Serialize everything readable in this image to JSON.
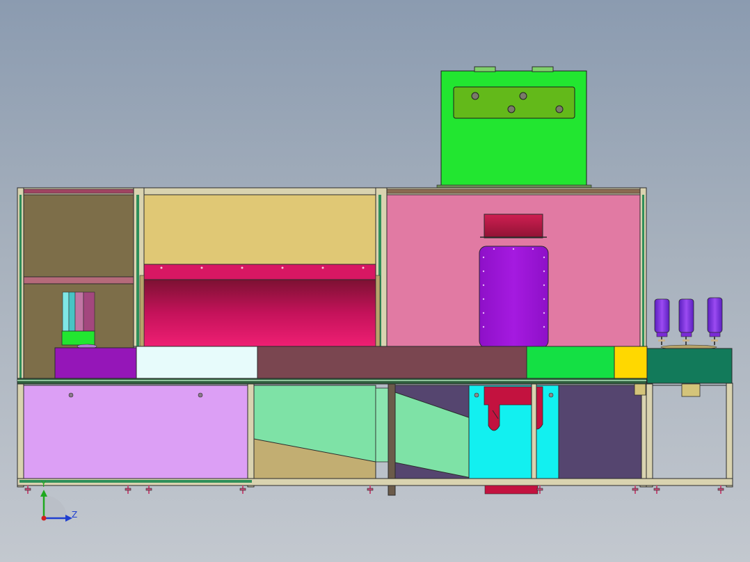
{
  "view": {
    "background_top": "#8b9bb0",
    "background_bottom": "#c3c8cf"
  },
  "triad": {
    "y_label": "Y",
    "z_label": "Z",
    "y_color": "#1fa81f",
    "z_color": "#1f3fd0",
    "x_color": "#d01f1f"
  },
  "colors": {
    "frame": "#d9d3b0",
    "frame_edge": "#2b2b2b",
    "left_upper_panel": "#7d6e49",
    "center_upper_panel": "#e0c875",
    "right_upper_panel": "#e17aa3",
    "crimson": "#d81763",
    "hood_top": "#bf1d45",
    "purple_box": "#9b12d4",
    "conveyor_purple": "#9516b8",
    "conveyor_white": "#e7fbfb",
    "conveyor_brown": "#7a4650",
    "conveyor_green": "#14e044",
    "conveyor_yellow": "#ffd800",
    "conveyor_teal": "#127a5a",
    "lower_lilac": "#dc9ff5",
    "lower_mint": "#7ee2a6",
    "lower_tan": "#c2ae72",
    "lower_navy": "#55456f",
    "lower_cyan": "#12f0f0",
    "top_box_green": "#22e630",
    "top_plate_green": "#63b91a",
    "bottle_violet": "#8a2be2",
    "rail_green": "#2f8f5a"
  },
  "parts": [
    "frame",
    "top-box",
    "hood",
    "conveyor",
    "bottles",
    "legs"
  ]
}
